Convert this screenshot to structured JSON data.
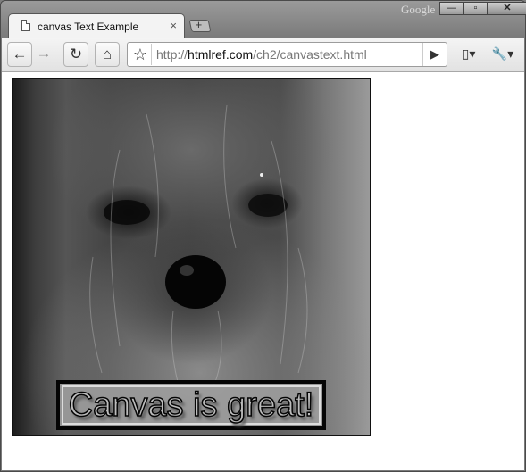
{
  "window": {
    "brand": "Google",
    "controls": {
      "minimize": "—",
      "maximize": "▫",
      "close": "✕"
    }
  },
  "tab": {
    "title": "canvas Text Example",
    "close": "×",
    "new_tab_symbol": "+"
  },
  "toolbar": {
    "back": "←",
    "forward": "→",
    "reload": "↻",
    "home": "⌂",
    "star": "☆",
    "url_host": "htmlref.com",
    "url_prefix": "http://",
    "url_path": "/ch2/canvastext.html",
    "go": "▶",
    "page_menu": "▯▾",
    "tools_menu": "🔧▾"
  },
  "content": {
    "canvas_text": "Canvas is great!"
  }
}
